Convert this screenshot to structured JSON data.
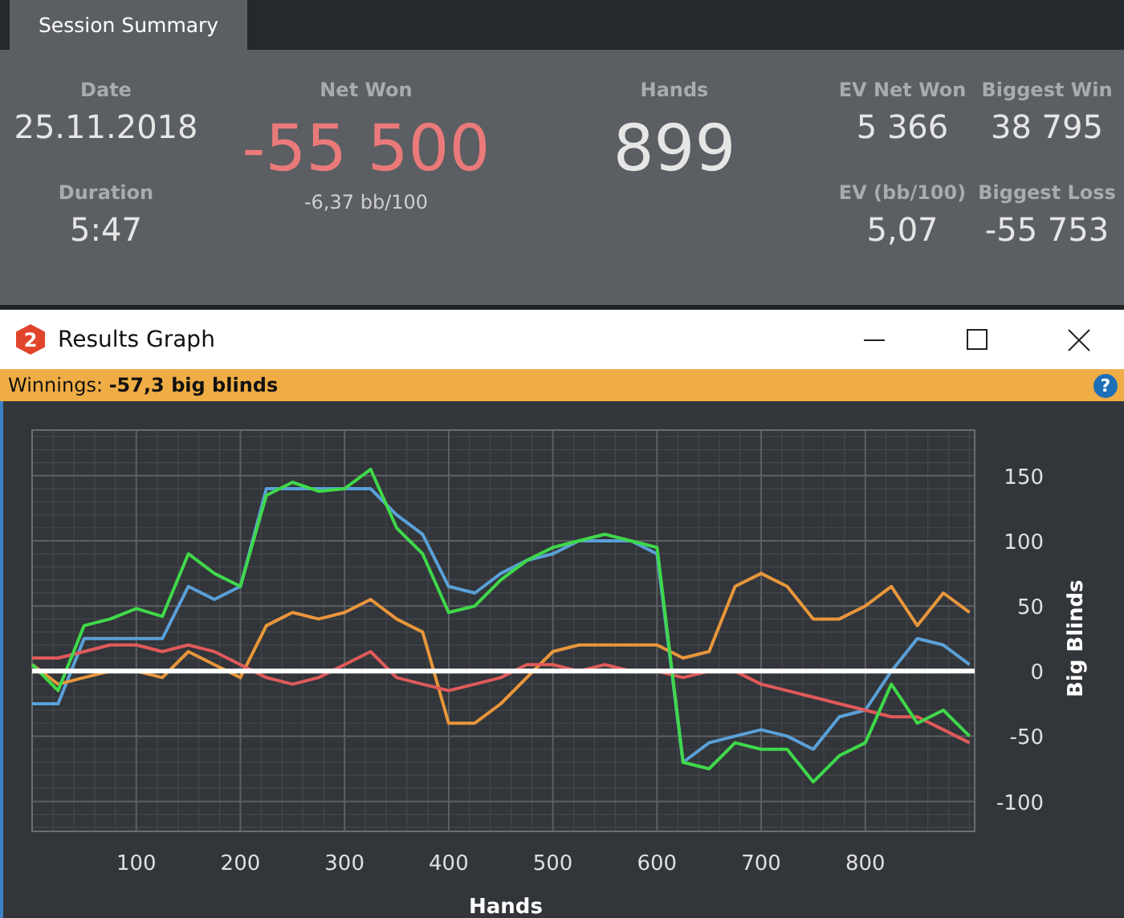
{
  "tabs": [
    {
      "label": "Session Summary",
      "selected": true
    }
  ],
  "summary": {
    "date": {
      "label": "Date",
      "value": "25.11.2018"
    },
    "duration": {
      "label": "Duration",
      "value": "5:47"
    },
    "net_won": {
      "label": "Net Won",
      "value": "-55 500",
      "sub": "-6,37 bb/100"
    },
    "hands": {
      "label": "Hands",
      "value": "899"
    },
    "ev_net_won": {
      "label": "EV Net Won",
      "value": "5 366"
    },
    "biggest_win": {
      "label": "Biggest Win",
      "value": "38 795"
    },
    "ev_bb100": {
      "label": "EV (bb/100)",
      "value": "5,07"
    },
    "biggest_loss": {
      "label": "Biggest Loss",
      "value": "-55 753"
    }
  },
  "graph_window": {
    "title": "Results Graph",
    "icon_glyph": "2",
    "info_text": "Winnings: **-57,3 big blinds**",
    "help_glyph": "?",
    "chart_data": {
      "type": "line",
      "grid": true,
      "xlabel": "Hands",
      "ylabel": "Big Blinds",
      "x": [
        0,
        25,
        50,
        75,
        100,
        125,
        150,
        175,
        200,
        225,
        250,
        275,
        300,
        325,
        350,
        375,
        400,
        425,
        450,
        475,
        500,
        525,
        550,
        575,
        600,
        625,
        650,
        675,
        700,
        725,
        750,
        775,
        800,
        825,
        850,
        875,
        900
      ],
      "series": [
        {
          "color": "#5aa0d8",
          "values": [
            -25,
            -25,
            25,
            25,
            25,
            25,
            65,
            55,
            65,
            140,
            140,
            140,
            140,
            140,
            120,
            105,
            65,
            60,
            75,
            85,
            90,
            100,
            100,
            100,
            90,
            -70,
            -55,
            -50,
            -45,
            -50,
            -60,
            -35,
            -30,
            0,
            25,
            20,
            5
          ]
        },
        {
          "color": "#e8963c",
          "values": [
            5,
            -10,
            -5,
            0,
            0,
            -5,
            15,
            5,
            -5,
            35,
            45,
            40,
            45,
            55,
            40,
            30,
            -40,
            -40,
            -25,
            -5,
            15,
            20,
            20,
            20,
            20,
            10,
            15,
            65,
            75,
            65,
            40,
            40,
            50,
            65,
            35,
            60,
            45
          ]
        },
        {
          "color": "#e05a5a",
          "values": [
            10,
            10,
            15,
            20,
            20,
            15,
            20,
            15,
            5,
            -5,
            -10,
            -5,
            5,
            15,
            -5,
            -10,
            -15,
            -10,
            -5,
            5,
            5,
            0,
            5,
            0,
            0,
            -5,
            0,
            0,
            -10,
            -15,
            -20,
            -25,
            -30,
            -35,
            -35,
            -45,
            -55
          ]
        },
        {
          "color": "#3fd84a",
          "values": [
            5,
            -15,
            35,
            40,
            48,
            42,
            90,
            75,
            65,
            135,
            145,
            138,
            140,
            155,
            110,
            90,
            45,
            50,
            70,
            85,
            95,
            100,
            105,
            100,
            95,
            -70,
            -75,
            -55,
            -60,
            -60,
            -85,
            -65,
            -55,
            -10,
            -40,
            -30,
            -50
          ]
        }
      ],
      "xlim": [
        0,
        905
      ],
      "ylim": [
        -123,
        185
      ],
      "xticks": [
        100,
        200,
        300,
        400,
        500,
        600,
        700,
        800
      ],
      "yticks": [
        -100,
        -50,
        0,
        50,
        100,
        150
      ]
    }
  }
}
